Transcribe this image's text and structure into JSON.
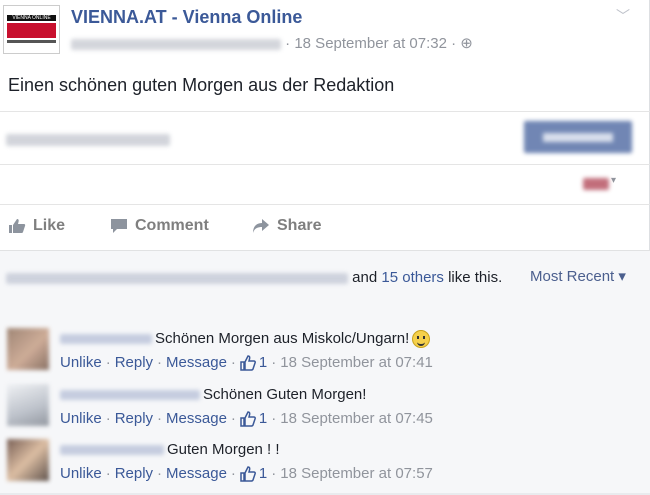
{
  "post": {
    "page_name": "VIENNA.AT - Vienna Online",
    "timestamp": "· 18 September at 07:32 ·",
    "text": "Einen schönen guten Morgen aus der Redaktion",
    "logo_text": "VIENNA ONLINE"
  },
  "actions": {
    "like": "Like",
    "comment": "Comment",
    "share": "Share"
  },
  "likes": {
    "and_text": "and",
    "others_link": "15 others",
    "like_this": "like this.",
    "sort_label": "Most Recent ▾"
  },
  "comments": [
    {
      "text": "Schönen Morgen aus Miskolc/Ungarn!",
      "unlike": "Unlike",
      "reply": "Reply",
      "message": "Message",
      "like_count": "1",
      "time": "18 September at 07:41"
    },
    {
      "text": "Schönen Guten Morgen!",
      "unlike": "Unlike",
      "reply": "Reply",
      "message": "Message",
      "like_count": "1",
      "time": "18 September at 07:45"
    },
    {
      "text": "Guten Morgen ! !",
      "unlike": "Unlike",
      "reply": "Reply",
      "message": "Message",
      "like_count": "1",
      "time": "18 September at 07:57"
    }
  ],
  "colors": {
    "brand_blue": "#3b5998",
    "boost_button": "#4e69a2",
    "muted": "#90949c"
  }
}
